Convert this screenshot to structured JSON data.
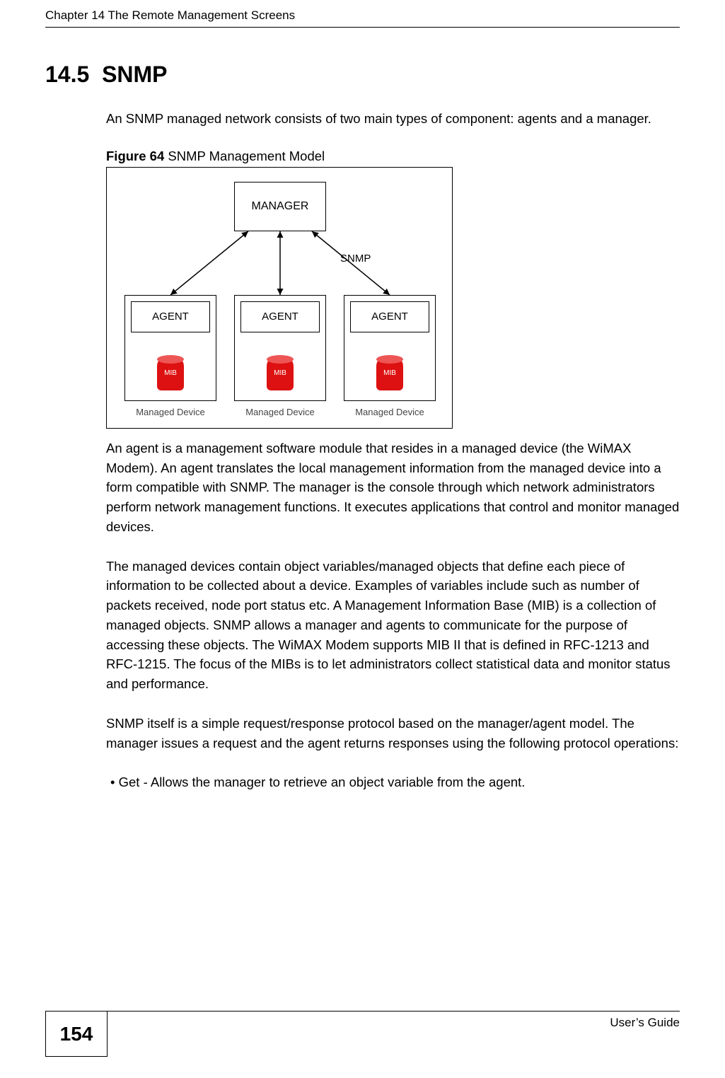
{
  "header": {
    "chapter_line": "Chapter 14 The Remote Management Screens"
  },
  "section": {
    "number": "14.5",
    "title": "SNMP"
  },
  "paragraphs": {
    "intro": "An SNMP managed network consists of two main types of component: agents and a manager.",
    "figure_label_bold": "Figure 64",
    "figure_label_rest": "   SNMP Management Model",
    "p2": "An agent is a management software module that resides in a managed device (the WiMAX Modem). An agent translates the local management information from the managed device into a form compatible with SNMP. The manager is the console through which network administrators perform network management functions. It executes applications that control and monitor managed devices.",
    "p3": "The managed devices contain object variables/managed objects that define each piece of information to be collected about a device. Examples of variables include such as number of packets received, node port status etc. A Management Information Base (MIB) is a collection of managed objects. SNMP allows a manager and agents to communicate for the purpose of accessing these objects. The WiMAX Modem supports MIB II that is defined in RFC-1213 and RFC-1215. The focus of the MIBs is to let administrators collect statistical data and monitor status and performance.",
    "p4": "SNMP itself is a simple request/response protocol based on the manager/agent model. The manager issues a request and the agent returns responses using the following protocol operations:",
    "bullet1": "• Get - Allows the manager to retrieve an object variable from the agent."
  },
  "figure": {
    "manager": "MANAGER",
    "snmp": "SNMP",
    "agent": "AGENT",
    "mib": "MIB",
    "managed_device": "Managed Device"
  },
  "footer": {
    "page_number": "154",
    "guide": "User’s Guide"
  }
}
